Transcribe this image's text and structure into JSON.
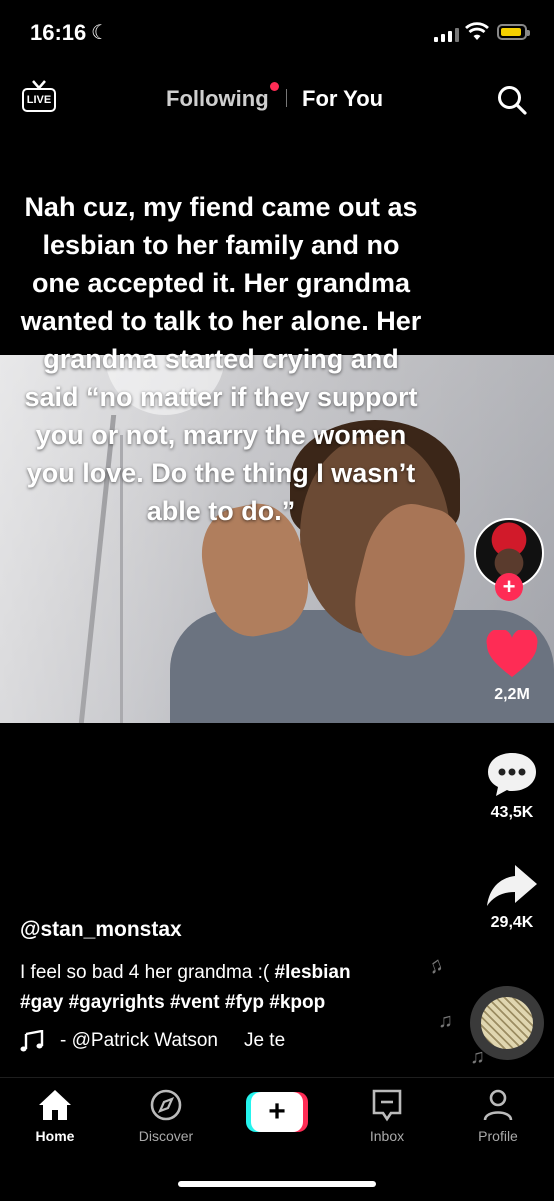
{
  "status_bar": {
    "time": "16:16",
    "moon_icon": "moon-icon",
    "battery_color": "#f5d000"
  },
  "top_bar": {
    "live_label": "LIVE",
    "tabs": [
      {
        "label": "Following",
        "active": false,
        "has_dot": true
      },
      {
        "label": "For You",
        "active": true
      }
    ],
    "accent": "#fe2c55"
  },
  "video": {
    "caption": "Nah cuz, my fiend came out as lesbian to her family and no one accepted it. Her grandma wanted to talk to her alone. Her grandma started crying and said “no matter if they support you or not, marry the women you love. Do the thing I wasn’t able to do.”"
  },
  "actions": {
    "likes": "2,2M",
    "comments": "43,5K",
    "shares": "29,4K",
    "follow_symbol": "+"
  },
  "post": {
    "username": "@stan_monstax",
    "description_text": "I feel so bad 4 her grandma :( ",
    "hashtags": [
      "#lesbian",
      "#gay",
      "#gayrights",
      "#vent",
      "#fyp",
      "#kpop"
    ],
    "music_artist": "- @Patrick Watson",
    "music_title": "Je te"
  },
  "bottom_nav": {
    "items": [
      {
        "label": "Home",
        "active": true
      },
      {
        "label": "Discover",
        "active": false
      },
      {
        "label": "+",
        "active": false
      },
      {
        "label": "Inbox",
        "active": false
      },
      {
        "label": "Profile",
        "active": false
      }
    ]
  }
}
